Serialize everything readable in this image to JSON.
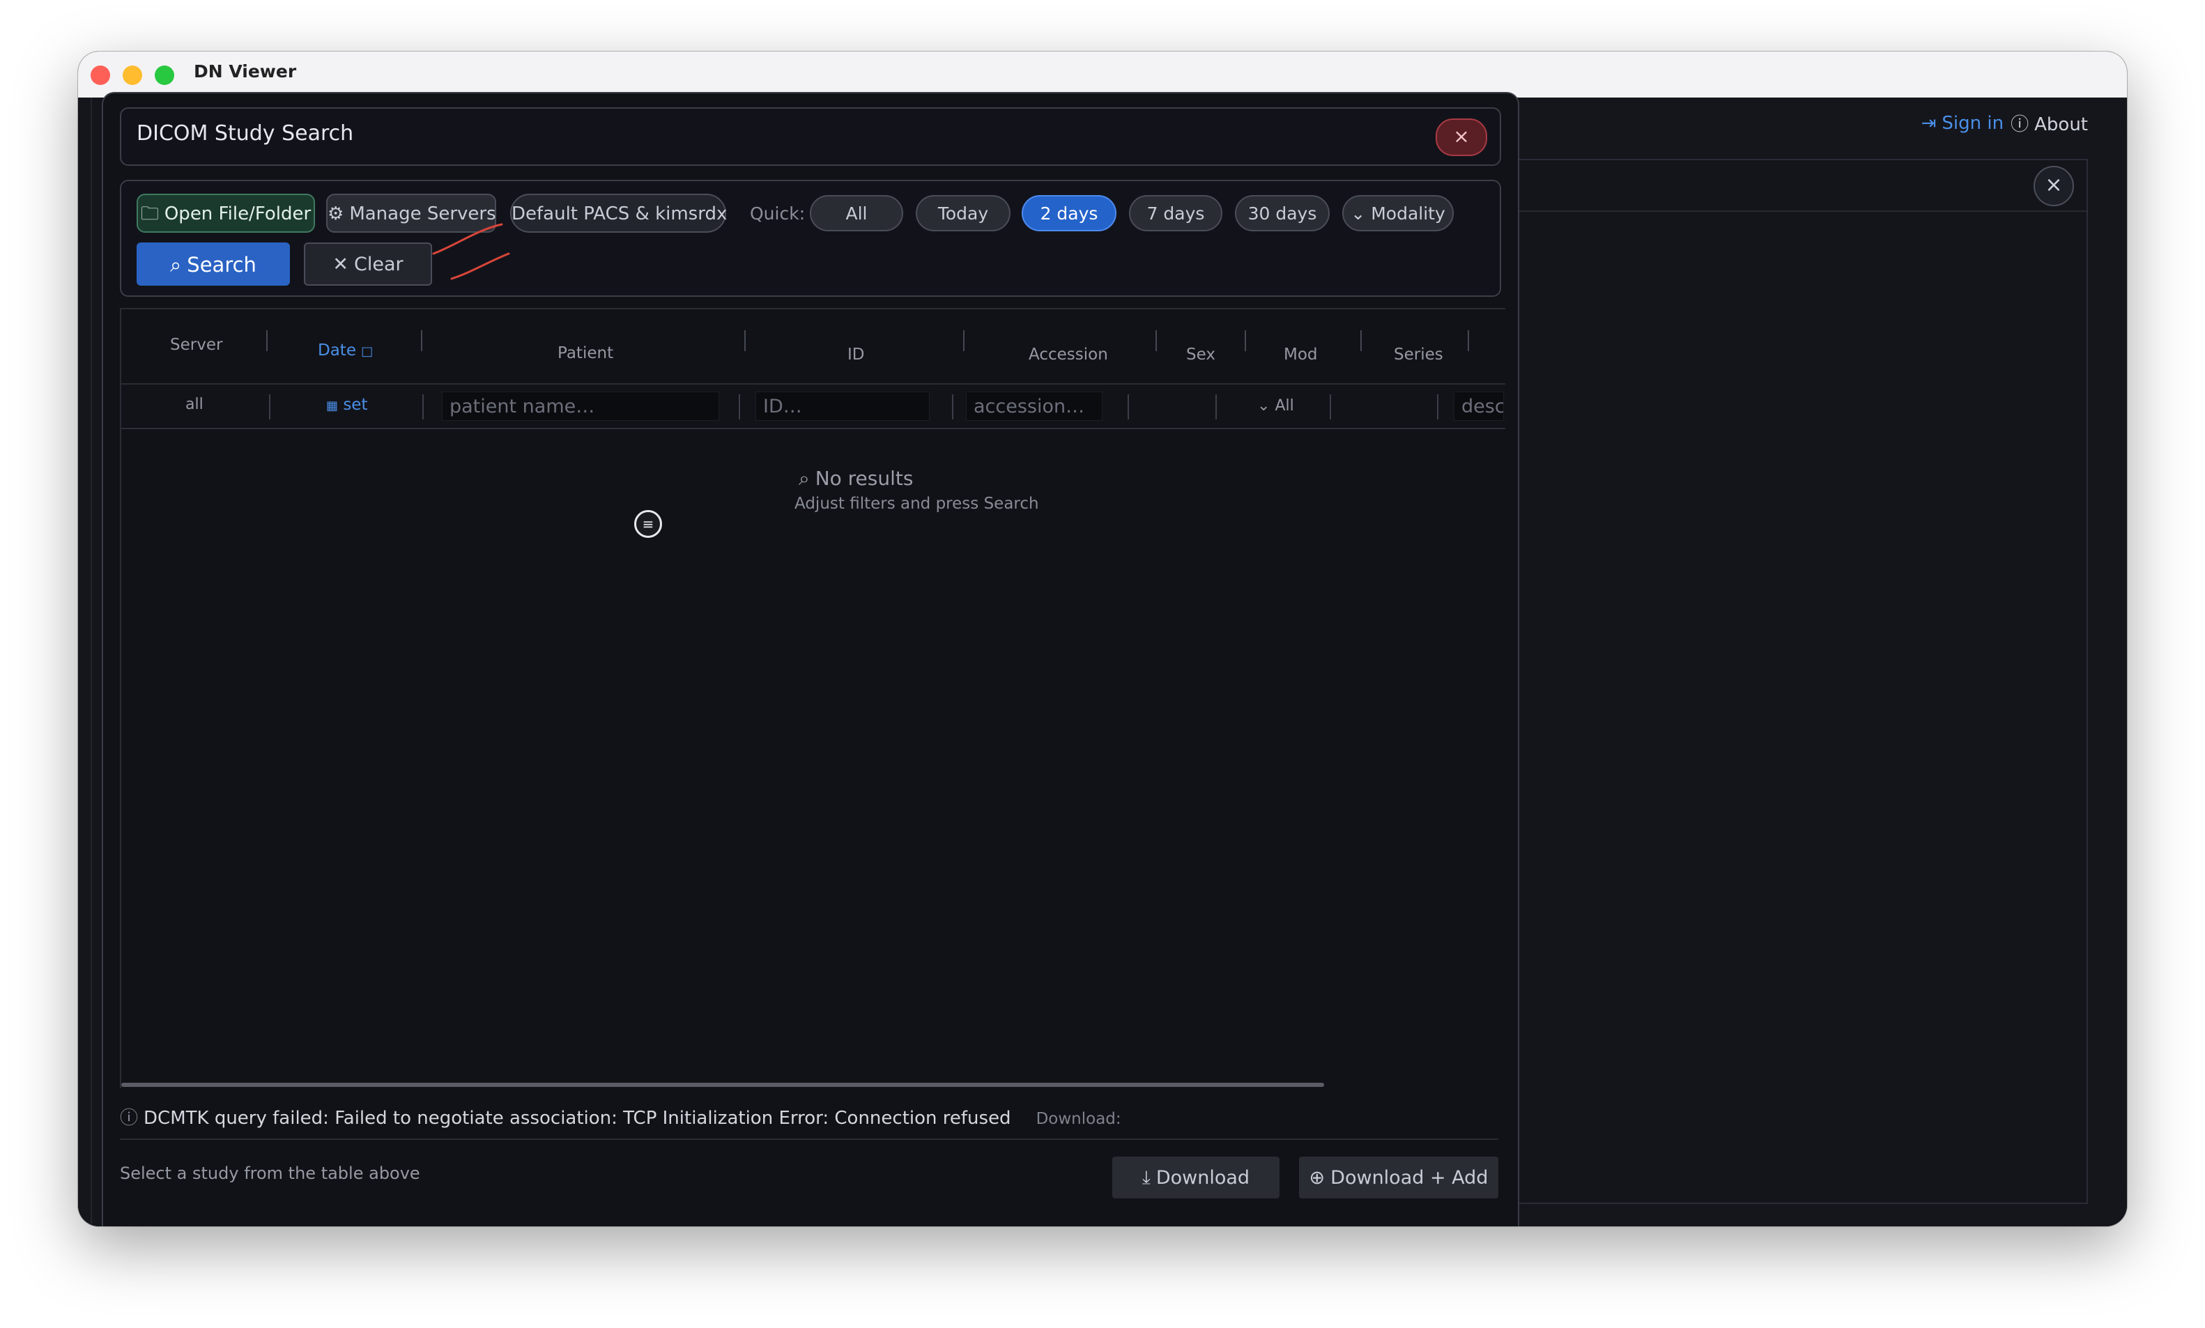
{
  "window": {
    "title": "DN Viewer"
  },
  "topbar": {
    "sign_in": "Sign in",
    "about": "About"
  },
  "dialog": {
    "title": "DICOM Study Search",
    "close_icon": "close-icon"
  },
  "toolbar": {
    "open_label": "Open File/Folder",
    "manage_label": "Manage Servers",
    "pacs_label": "Default PACS & kimsrdx",
    "quick_label": "Quick:",
    "quick": [
      "All",
      "Today",
      "2 days",
      "7 days",
      "30 days"
    ],
    "quick_selected": "2 days",
    "modality_label": "Modality",
    "search_label": "Search",
    "clear_label": "Clear",
    "accent": "#2a63c4",
    "annotation_color": "#d8453a"
  },
  "table": {
    "headers": {
      "server": "Server",
      "date": "Date",
      "patient": "Patient",
      "id": "ID",
      "accession": "Accession",
      "sex": "Sex",
      "mod": "Mod",
      "series": "Series"
    },
    "filters": {
      "server": "all",
      "date": "set",
      "patient_placeholder": "patient name…",
      "id_placeholder": "ID…",
      "accession_placeholder": "accession…",
      "mod": "All",
      "desc_placeholder": "desc"
    },
    "empty_title": "No results",
    "empty_sub": "Adjust filters and press Search"
  },
  "status": {
    "message": "DCMTK query failed: Failed to negotiate association: TCP Initialization Error: Connection refused",
    "download_label": "Download:",
    "hint": "Select a study from the table above",
    "download_button": "Download",
    "download_add_button": "Download + Add"
  }
}
